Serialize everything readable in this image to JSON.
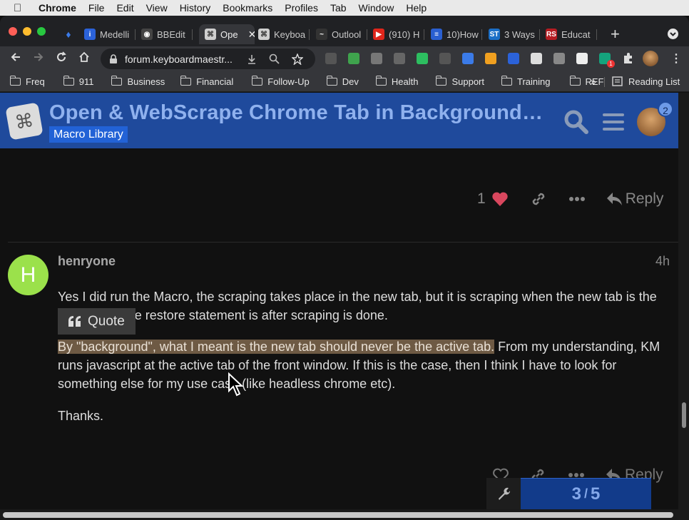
{
  "menubar": {
    "app": "Chrome",
    "items": [
      "File",
      "Edit",
      "View",
      "History",
      "Bookmarks",
      "Profiles",
      "Tab",
      "Window",
      "Help"
    ]
  },
  "tabs": [
    {
      "label": "Medelli",
      "color": "#2b62d9",
      "glyph": "i"
    },
    {
      "label": "BBEdit",
      "color": "#444",
      "glyph": "◉"
    },
    {
      "label": "Ope",
      "color": "#cfcfcf",
      "glyph": "⌘",
      "active": true,
      "close": "✕"
    },
    {
      "label": "Keyboa",
      "color": "#cfcfcf",
      "glyph": "⌘"
    },
    {
      "label": "Outlool",
      "color": "#333",
      "glyph": "~"
    },
    {
      "label": "(910) H",
      "color": "#e0261b",
      "glyph": "▶"
    },
    {
      "label": "10)How",
      "color": "#2a5fd0",
      "glyph": "≡"
    },
    {
      "label": "3 Ways",
      "color": "#1b6fc7",
      "glyph": "ST"
    },
    {
      "label": "Educat",
      "color": "#b51c22",
      "glyph": "RS"
    }
  ],
  "toolbar": {
    "url": "forum.keyboardmaestr...",
    "new_tab": "+",
    "ext_badge": "1",
    "extensions": [
      {
        "name": "shield-extension-icon",
        "color": "#555"
      },
      {
        "name": "printer-extension-icon",
        "color": "#3fa34d"
      },
      {
        "name": "reader-extension-icon",
        "color": "#777"
      },
      {
        "name": "tabs-extension-icon",
        "color": "#666"
      },
      {
        "name": "evernote-extension-icon",
        "color": "#2dbe60"
      },
      {
        "name": "1password-extension-icon",
        "color": "#555"
      },
      {
        "name": "gem-extension-icon",
        "color": "#3b7be8"
      },
      {
        "name": "star-extension-icon",
        "color": "#f0a020"
      },
      {
        "name": "circle-extension-icon",
        "color": "#2b62d9"
      },
      {
        "name": "window-extension-icon",
        "color": "#ddd"
      },
      {
        "name": "download-extension-icon",
        "color": "#888"
      },
      {
        "name": "v-extension-icon",
        "color": "#eee"
      },
      {
        "name": "grammarly-extension-icon",
        "color": "#15a37d"
      }
    ]
  },
  "bookmarks": {
    "items": [
      "Freq",
      "911",
      "Business",
      "Financial",
      "Follow-Up",
      "Dev",
      "Health",
      "Support",
      "Training",
      "REF"
    ],
    "overflow": "»",
    "reading_list": "Reading List"
  },
  "forum": {
    "title": "Open & WebScrape Chrome Tab in Background…",
    "category": "Macro Library",
    "notification_count": "2"
  },
  "prev_post": {
    "like_count": "1",
    "reply_label": "Reply"
  },
  "post": {
    "avatar_letter": "H",
    "username": "henryone",
    "time": "4h",
    "para1": "Yes I did run the Macro, the scraping takes place in the new tab, but it is scraping when the new tab is the active tab. The restore statement is after scraping is done.",
    "para2_highlight": "By \"background\", what I meant is the new tab should never be the active tab.",
    "para2_rest": " From my understanding, KM runs javascript at the active tab of the front window. If this is the case, then I think I have to look for something else for my use case (like headless chrome etc).",
    "para3": "Thanks.",
    "quote_label": "Quote",
    "reply_label": "Reply"
  },
  "timeline": {
    "current": "3",
    "separator": "/",
    "total": "5"
  }
}
